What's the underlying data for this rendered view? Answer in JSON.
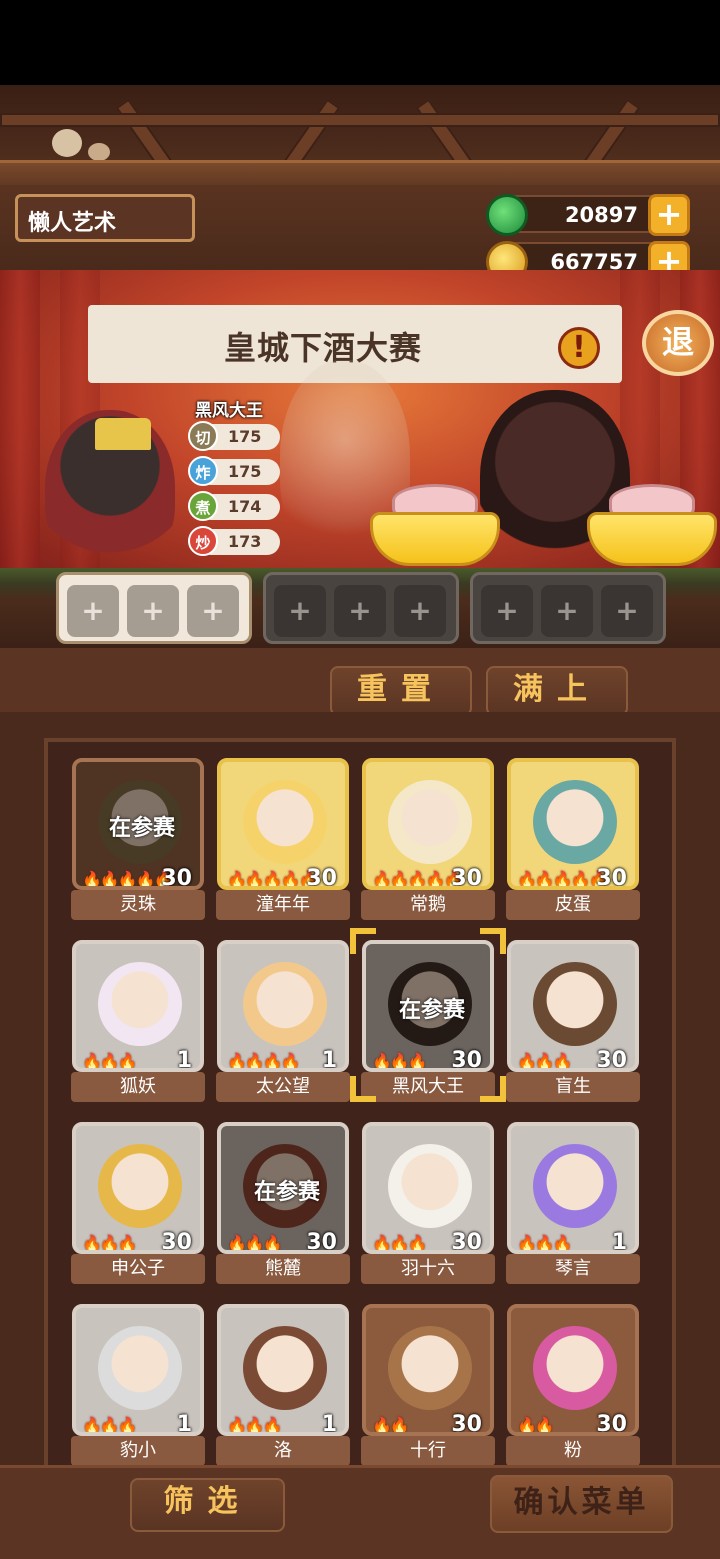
{
  "header": {
    "player_name": "懒人艺术",
    "currency": [
      {
        "icon": "jade-coin-icon",
        "value": "20897"
      },
      {
        "icon": "gold-coin-icon",
        "value": "667757"
      }
    ],
    "plus_label": "+"
  },
  "stage": {
    "banner_title": "皇城下酒大赛",
    "banner_icon": "!",
    "exit_label": "退",
    "featured_name": "黑风大王",
    "stats": [
      {
        "label": "切",
        "value": "175",
        "color": "#8a7a55"
      },
      {
        "label": "炸",
        "value": "175",
        "color": "#4aa3d8"
      },
      {
        "label": "煮",
        "value": "174",
        "color": "#6aa53a"
      },
      {
        "label": "炒",
        "value": "173",
        "color": "#d9463a"
      }
    ]
  },
  "slots": {
    "plus_label": "+"
  },
  "actions": {
    "reset_label": "重置",
    "fill_label": "满上"
  },
  "in_play_label": "在参赛",
  "roster": [
    {
      "name": "灵珠",
      "level": "30",
      "flames": 5,
      "in_play": true,
      "tier": "bronze",
      "color": "#7a6a40"
    },
    {
      "name": "潼年年",
      "level": "30",
      "flames": 5,
      "in_play": false,
      "tier": "gold",
      "color": "#f6d36a"
    },
    {
      "name": "常鹅",
      "level": "30",
      "flames": 5,
      "in_play": false,
      "tier": "gold",
      "color": "#f4e8c8"
    },
    {
      "name": "皮蛋",
      "level": "30",
      "flames": 5,
      "in_play": false,
      "tier": "gold",
      "color": "#6aa8a4"
    },
    {
      "name": "狐妖",
      "level": "1",
      "flames": 3,
      "in_play": false,
      "tier": "silver",
      "color": "#f2e6f2"
    },
    {
      "name": "太公望",
      "level": "1",
      "flames": 4,
      "in_play": false,
      "tier": "silver",
      "color": "#f2c98a"
    },
    {
      "name": "黑风大王",
      "level": "30",
      "flames": 3,
      "in_play": true,
      "tier": "silver",
      "color": "#2a2220"
    },
    {
      "name": "盲生",
      "level": "30",
      "flames": 3,
      "in_play": false,
      "tier": "silver",
      "color": "#6a4a32"
    },
    {
      "name": "申公子",
      "level": "30",
      "flames": 3,
      "in_play": false,
      "tier": "silver",
      "color": "#e6b84a"
    },
    {
      "name": "熊麓",
      "level": "30",
      "flames": 3,
      "in_play": true,
      "tier": "silver",
      "color": "#8a3a2a"
    },
    {
      "name": "羽十六",
      "level": "30",
      "flames": 3,
      "in_play": false,
      "tier": "silver",
      "color": "#f4f0ea"
    },
    {
      "name": "琴言",
      "level": "1",
      "flames": 3,
      "in_play": false,
      "tier": "silver",
      "color": "#9a7ae0"
    },
    {
      "name": "豹小",
      "level": "1",
      "flames": 3,
      "in_play": false,
      "tier": "silver",
      "color": "#dcdcdc"
    },
    {
      "name": "洛",
      "level": "1",
      "flames": 3,
      "in_play": false,
      "tier": "silver",
      "color": "#7a4a35"
    },
    {
      "name": "十行",
      "level": "30",
      "flames": 2,
      "in_play": false,
      "tier": "bronze",
      "color": "#a7744a"
    },
    {
      "name": "粉",
      "level": "30",
      "flames": 2,
      "in_play": false,
      "tier": "bronze",
      "color": "#d85aa0"
    }
  ],
  "selected_name": "黑风大王",
  "bottom": {
    "filter_label": "筛选",
    "confirm_label": "确认菜单"
  }
}
